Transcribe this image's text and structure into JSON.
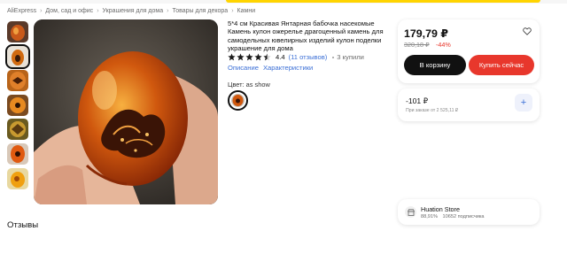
{
  "breadcrumb": [
    "AliExpress",
    "Дом, сад и офис",
    "Украшения для дома",
    "Товары для декора",
    "Камни"
  ],
  "product": {
    "title": "5*4 см Красивая Янтарная бабочка насекомые Камень кулон ожерелье драгоценный камень для самодельных ювелирных изделий кулон поделки украшение для дома",
    "rating": "4.4",
    "rating_fraction": 0.88,
    "reviews": "(11 отзывов)",
    "sold": "3 купили",
    "tab_description": "Описание",
    "tab_specs": "Характеристики",
    "color_label": "Цвет: as show"
  },
  "buybox": {
    "price": "179,79 ₽",
    "old_price": "320,18 ₽",
    "discount": "-44%",
    "cart_label": "В корзину",
    "buy_label": "Купить сейчас",
    "wishlist_icon": "heart-icon"
  },
  "coupon": {
    "amount": "-101 ₽",
    "condition": "При заказе от 2 525,11 ₽",
    "add_icon": "plus-icon"
  },
  "store": {
    "name": "Huation Store",
    "positive": "88,91%",
    "followers": "10652 подписчика",
    "icon": "store-icon"
  },
  "reviews_heading": "Отзывы",
  "colors": {
    "accent_red": "#e8372c",
    "link_blue": "#3b6fd6",
    "top_yellow": "#ffd400",
    "star": "#1a1a1a"
  }
}
